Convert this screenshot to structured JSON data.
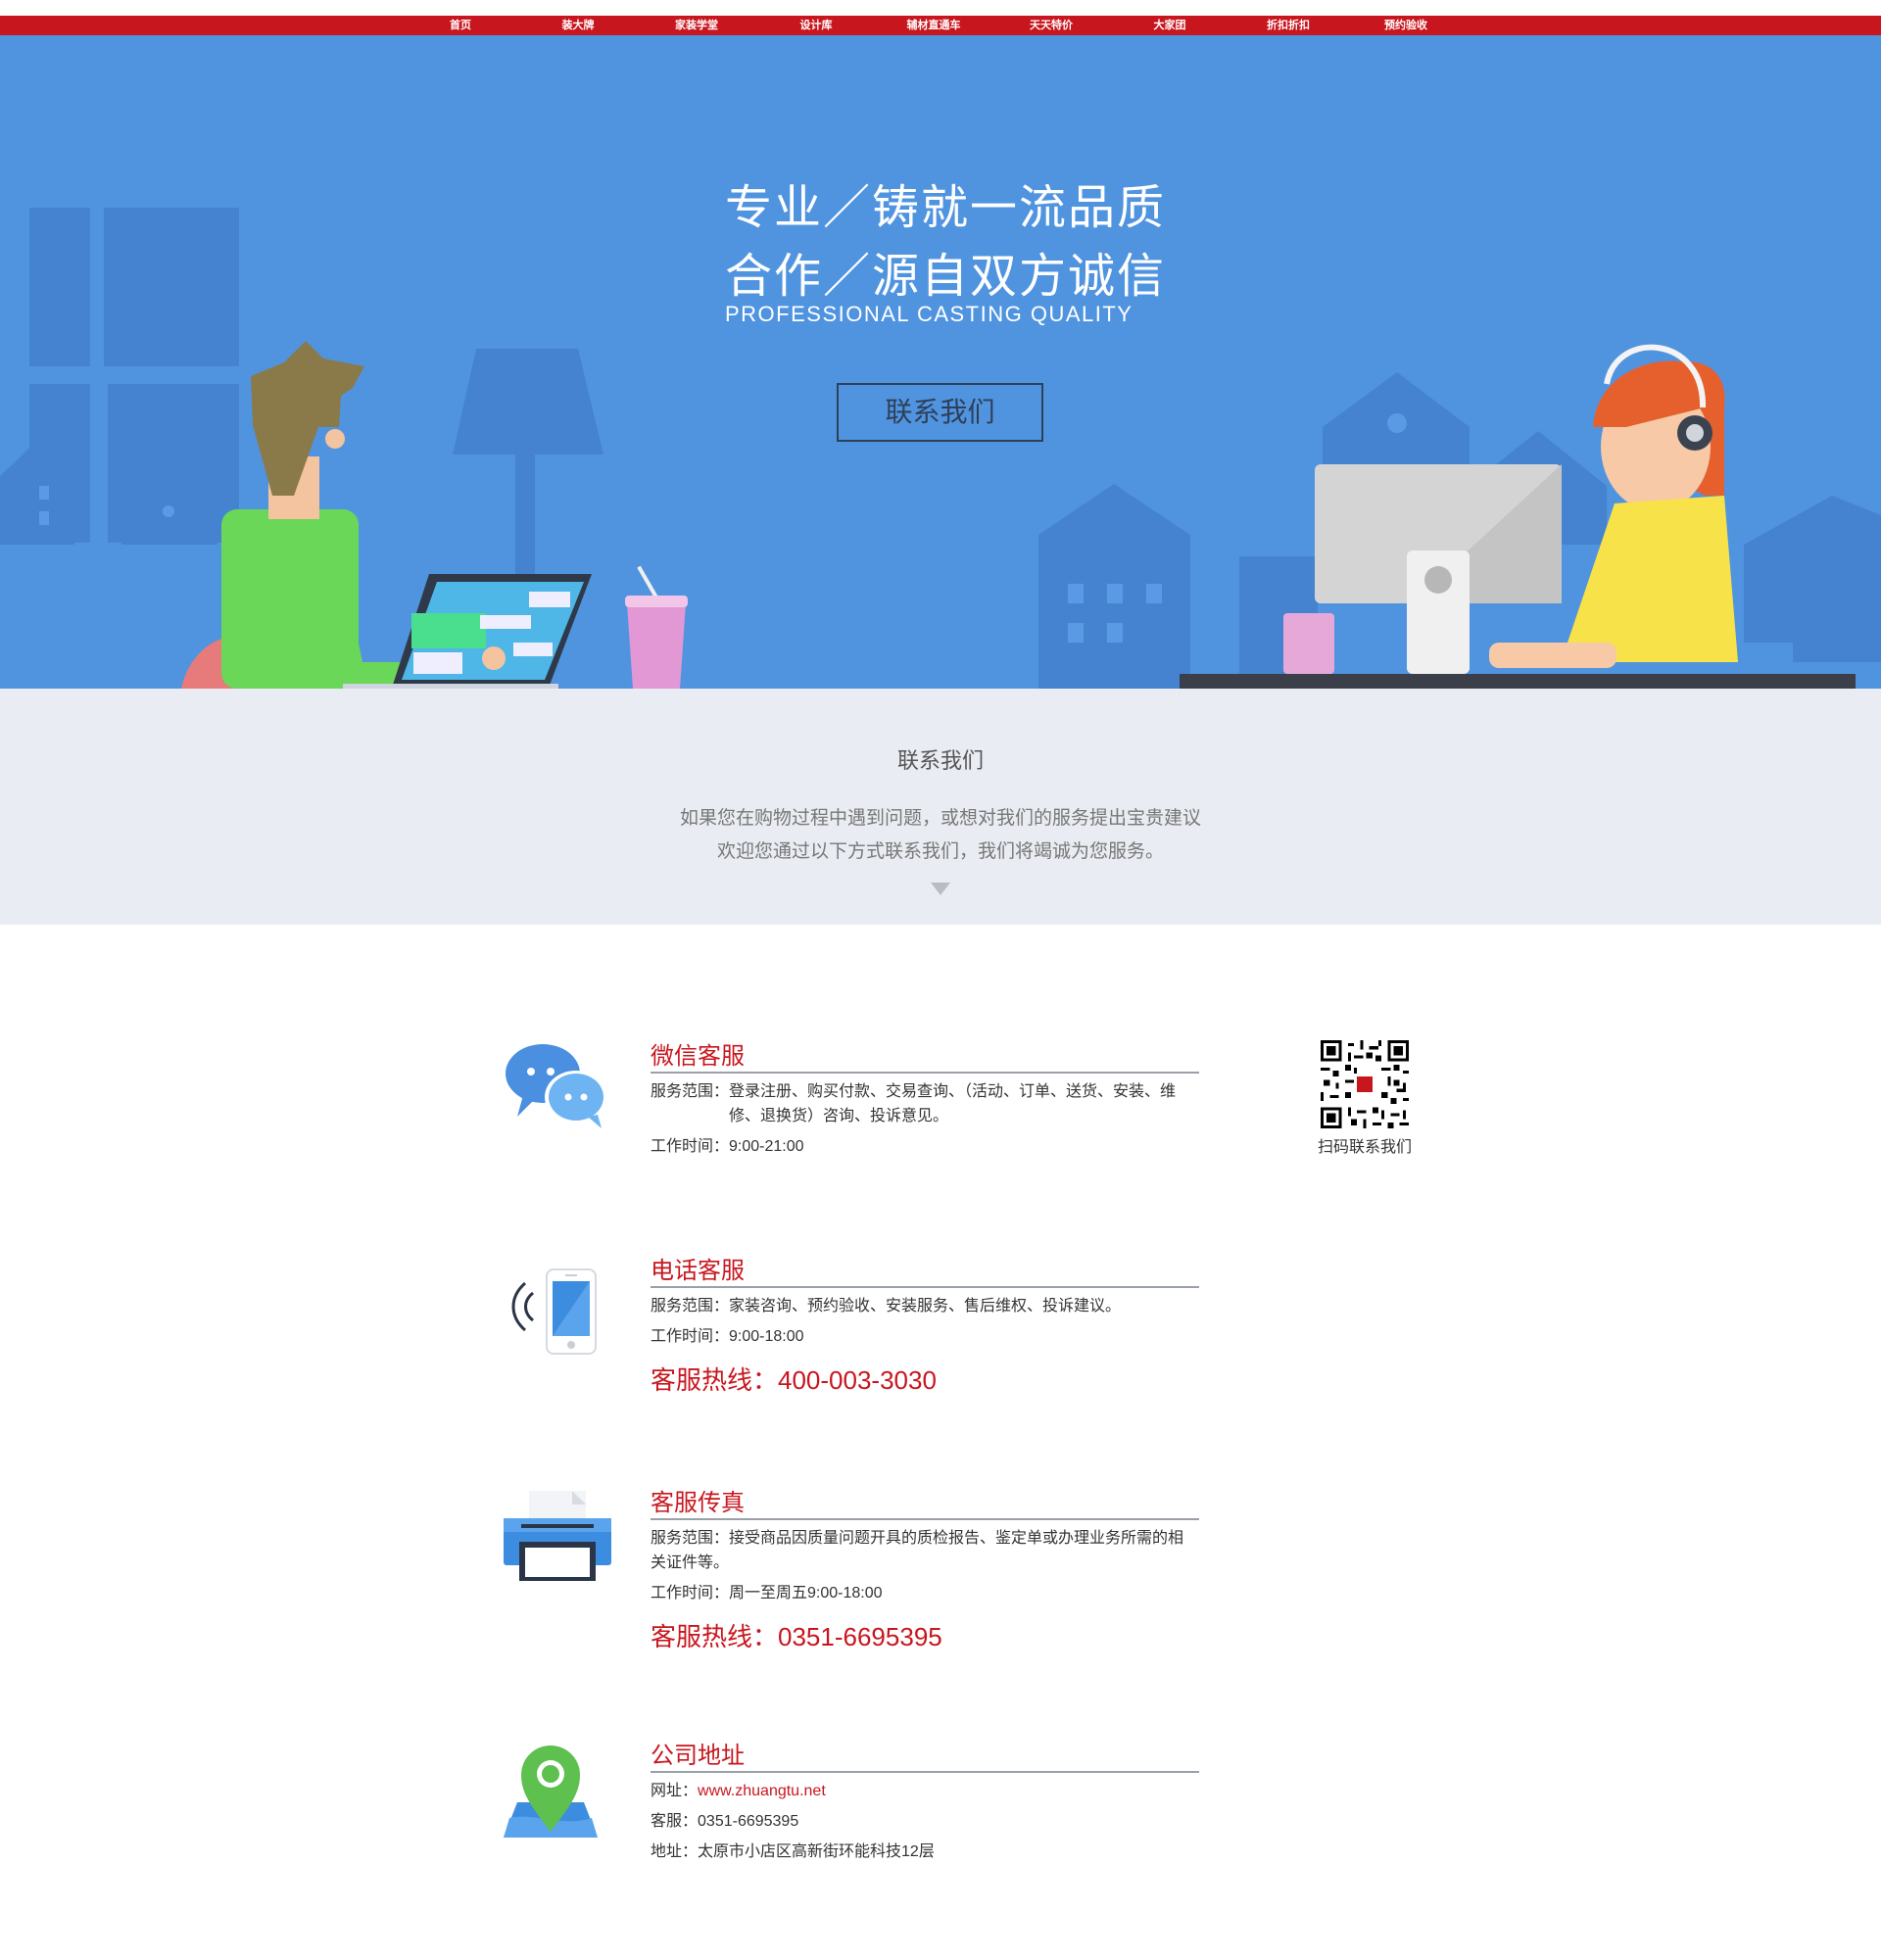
{
  "nav": {
    "items": [
      "首页",
      "装大牌",
      "家装学堂",
      "设计库",
      "辅材直通车",
      "天天特价",
      "大家团",
      "折扣折扣",
      "预约验收"
    ]
  },
  "hero": {
    "line1": "专业／铸就一流品质",
    "line2": "合作／源自双方诚信",
    "subtitle": "PROFESSIONAL CASTING QUALITY",
    "button": "联系我们"
  },
  "intro": {
    "title": "联系我们",
    "line1": "如果您在购物过程中遇到问题，或想对我们的服务提出宝贵建议",
    "line2": "欢迎您通过以下方式联系我们，我们将竭诚为您服务。"
  },
  "wechat": {
    "title": "微信客服",
    "scope_label": "服务范围：",
    "scope": "登录注册、购买付款、交易查询、（活动、订单、送货、安装、维修、退换货）咨询、投诉意见。",
    "hours_label": "工作时间：",
    "hours": "9:00-21:00",
    "qr_label": "扫码联系我们"
  },
  "phone": {
    "title": "电话客服",
    "scope_label": "服务范围：",
    "scope": "家装咨询、预约验收、安装服务、售后维权、投诉建议。",
    "hours_label": "工作时间：",
    "hours": "9:00-18:00",
    "hotline_label": "客服热线：",
    "hotline": "400-003-3030"
  },
  "fax": {
    "title": "客服传真",
    "scope_label": "服务范围：",
    "scope": "接受商品因质量问题开具的质检报告、鉴定单或办理业务所需的相关证件等。",
    "hours_label": "工作时间：",
    "hours": "周一至周五9:00-18:00",
    "hotline_label": "客服热线：",
    "hotline": "0351-6695395"
  },
  "address": {
    "title": "公司地址",
    "site_label": "网址：",
    "site": "www.zhuangtu.net",
    "service_label": "客服：",
    "service": "0351-6695395",
    "addr_label": "地址：",
    "addr": "太原市小店区高新街环能科技12层"
  },
  "colors": {
    "brand_red": "#c8161e",
    "hero_blue": "#5094e0",
    "intro_bg": "#eaecf3",
    "icon_blue": "#4a8fe0"
  },
  "icons": [
    "chat-bubbles-icon",
    "mobile-phone-icon",
    "printer-icon",
    "map-pin-icon",
    "qr-code",
    "down-arrow-icon"
  ]
}
